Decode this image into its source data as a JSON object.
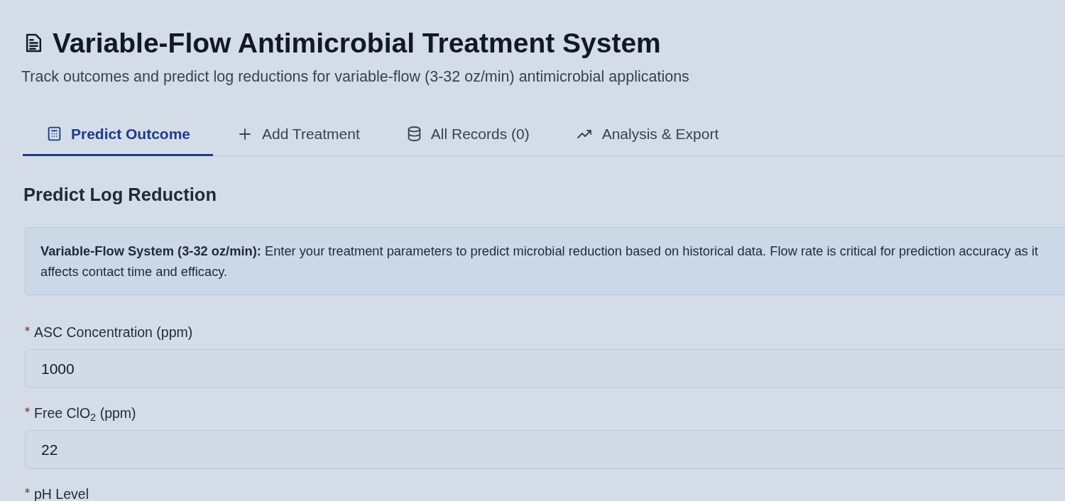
{
  "header": {
    "title": "Variable-Flow Antimicrobial Treatment System",
    "subtitle": "Track outcomes and predict log reductions for variable-flow (3-32 oz/min) antimicrobial applications"
  },
  "tabs": [
    {
      "label": "Predict Outcome",
      "kind": "calculator",
      "selected": true
    },
    {
      "label": "Add Treatment",
      "kind": "plus",
      "selected": false
    },
    {
      "label": "All Records (0)",
      "kind": "database",
      "selected": false
    },
    {
      "label": "Analysis & Export",
      "kind": "trend",
      "selected": false
    }
  ],
  "section": {
    "heading": "Predict Log Reduction",
    "info": "**Variable-Flow System (3-32 oz/min):** Enter your treatment parameters to predict microbial reduction based on historical data. Flow rate is critical for prediction accuracy as it affects contact time and efficacy."
  },
  "fields": [
    {
      "label": "ASC Concentration (ppm)",
      "required": true,
      "value": "1000"
    },
    {
      "label": "Free ClO$_{2}$ (ppm)",
      "required": true,
      "value": "22"
    },
    {
      "label": "pH Level",
      "required": true
    }
  ]
}
